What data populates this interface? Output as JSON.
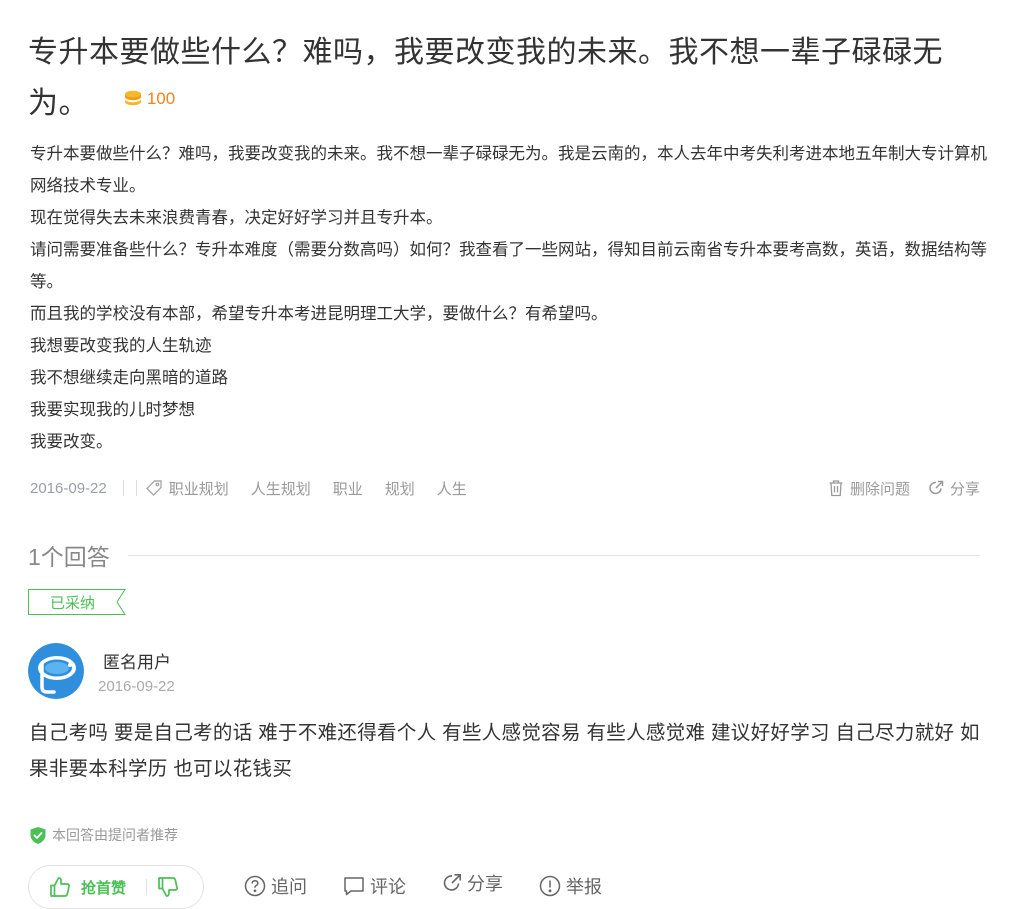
{
  "question": {
    "title": "专升本要做些什么？难吗，我要改变我的未来。我不想一辈子碌碌无为。",
    "reward": "100",
    "body": [
      "专升本要做些什么？难吗，我要改变我的未来。我不想一辈子碌碌无为。我是云南的，本人去年中考失利考进本地五年制大专计算机网络技术专业。",
      "现在觉得失去未来浪费青春，决定好好学习并且专升本。",
      "请问需要准备些什么？专升本难度（需要分数高吗）如何？我查看了一些网站，得知目前云南省专升本要考高数，英语，数据结构等等。",
      "而且我的学校没有本部，希望专升本考进昆明理工大学，要做什么？有希望吗。",
      "我想要改变我的人生轨迹",
      "我不想继续走向黑暗的道路",
      "我要实现我的儿时梦想",
      "我要改变。"
    ],
    "date": "2016-09-22",
    "tags": [
      "职业规划",
      "人生规划",
      "职业",
      "规划",
      "人生"
    ],
    "delete_label": "删除问题",
    "share_label": "分享"
  },
  "answers_header": {
    "count_label": "1个回答"
  },
  "answer": {
    "adopted_label": "已采纳",
    "user_name": "匿名用户",
    "date": "2016-09-22",
    "body": "自己考吗 要是自己考的话 难于不难还得看个人 有些人感觉容易 有些人感觉难 建议好好学习 自己尽力就好 如果非要本科学历 也可以花钱买",
    "recommend_label": "本回答由提问者推荐",
    "upvote_label": "抢首赞",
    "actions": {
      "follow_up": "追问",
      "comment": "评论",
      "share": "分享",
      "report": "举报"
    }
  },
  "colors": {
    "accent_green": "#4cbf56",
    "reward_orange": "#f5811f",
    "muted_text": "#999999"
  }
}
